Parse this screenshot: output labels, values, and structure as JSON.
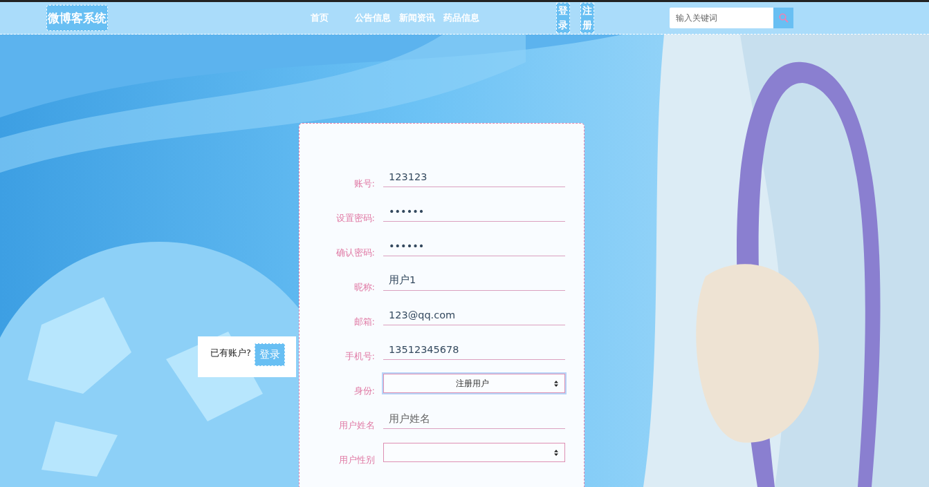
{
  "header": {
    "logo": "微博客系统",
    "nav": [
      {
        "label": "首页"
      },
      {
        "label": "公告信息"
      },
      {
        "label": "新闻资讯"
      },
      {
        "label": "药品信息"
      }
    ],
    "auth_buttons": [
      {
        "label": "登录"
      },
      {
        "label": "注册"
      }
    ],
    "search": {
      "placeholder": "输入关键词"
    }
  },
  "login_prompt": {
    "text": "已有账户?",
    "button": "登录"
  },
  "form": {
    "fields": [
      {
        "label": "账号:",
        "kind": "text",
        "value": "123123",
        "focused": false
      },
      {
        "label": "设置密码:",
        "kind": "text",
        "value": "••••••",
        "focused": false
      },
      {
        "label": "确认密码:",
        "kind": "text",
        "value": "••••••",
        "focused": false
      },
      {
        "label": "昵称:",
        "kind": "text",
        "value": "用户1",
        "focused": false
      },
      {
        "label": "邮箱:",
        "kind": "text",
        "value": "123@qq.com",
        "focused": false
      },
      {
        "label": "手机号:",
        "kind": "text",
        "value": "13512345678",
        "focused": false
      },
      {
        "label": "身份:",
        "kind": "select",
        "value": "注册用户",
        "focused": true
      },
      {
        "label": "用户姓名",
        "kind": "text",
        "placeholder": "用户姓名",
        "focused": false
      },
      {
        "label": "用户性别",
        "kind": "select",
        "focused": false
      }
    ]
  }
}
